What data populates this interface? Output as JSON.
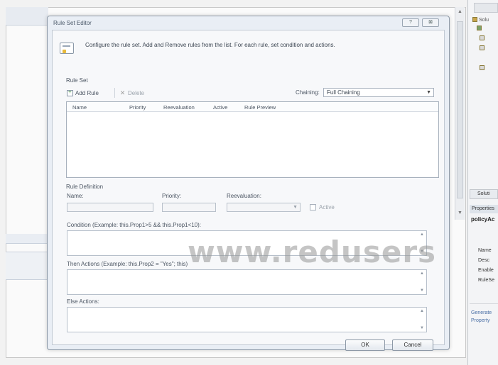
{
  "dialog": {
    "title": "Rule Set Editor",
    "help_button": "?",
    "close_button": "⊠",
    "header_text": "Configure the rule set. Add and Remove rules from the list. For each rule, set condition and actions."
  },
  "rule_set": {
    "section_label": "Rule Set",
    "add_rule_label": "Add Rule",
    "delete_label": "Delete",
    "chaining_label": "Chaining:",
    "chaining_value": "Full Chaining",
    "columns": [
      "Name",
      "Priority",
      "Reevaluation",
      "Active",
      "Rule Preview"
    ]
  },
  "rule_definition": {
    "section_label": "Rule Definition",
    "name_label": "Name:",
    "priority_label": "Priority:",
    "reevaluation_label": "Reevaluation:",
    "active_label": "Active",
    "condition_label": "Condition (Example: this.Prop1>5 && this.Prop1<10):",
    "then_label": "Then Actions (Example: this.Prop2 = \"Yes\"; this)",
    "else_label": "Else Actions:"
  },
  "buttons": {
    "ok": "OK",
    "cancel": "Cancel"
  },
  "right_panel": {
    "solution_tab": "Soluti",
    "tree_items": [
      "Solu",
      "",
      "",
      "",
      ""
    ],
    "properties_header": "Properties",
    "object_name": "policyAc",
    "property_rows": [
      "Name",
      "Desc",
      "Enable",
      "RuleSe"
    ],
    "links": [
      "Generate",
      "Property"
    ]
  },
  "watermark": "www.redusers"
}
